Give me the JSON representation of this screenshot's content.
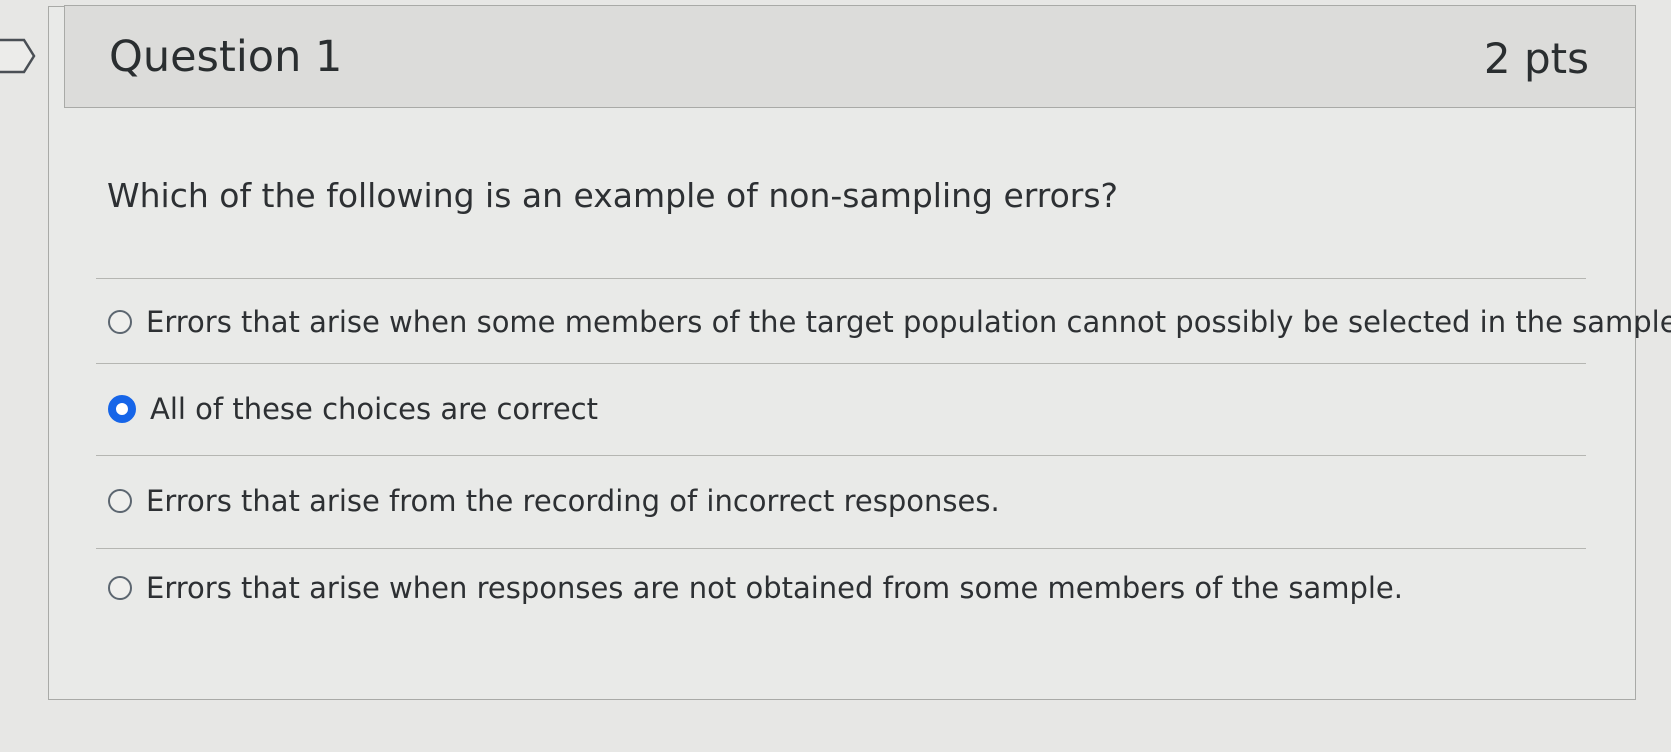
{
  "question": {
    "title": "Question 1",
    "points": "2 pts",
    "text": "Which of the following is an example of non-sampling errors?"
  },
  "answers": [
    {
      "label": "Errors that arise when some members of the target population cannot possibly be selected in the sample",
      "selected": false
    },
    {
      "label": "All of these choices are correct",
      "selected": true
    },
    {
      "label": "Errors that arise from the recording of incorrect responses.",
      "selected": false
    },
    {
      "label": "Errors that arise when responses are not obtained from some members of the sample.",
      "selected": false
    }
  ],
  "colors": {
    "selected_radio": "#1665e8",
    "header_bg": "#dcdcda",
    "card_bg": "#e9eae8"
  }
}
